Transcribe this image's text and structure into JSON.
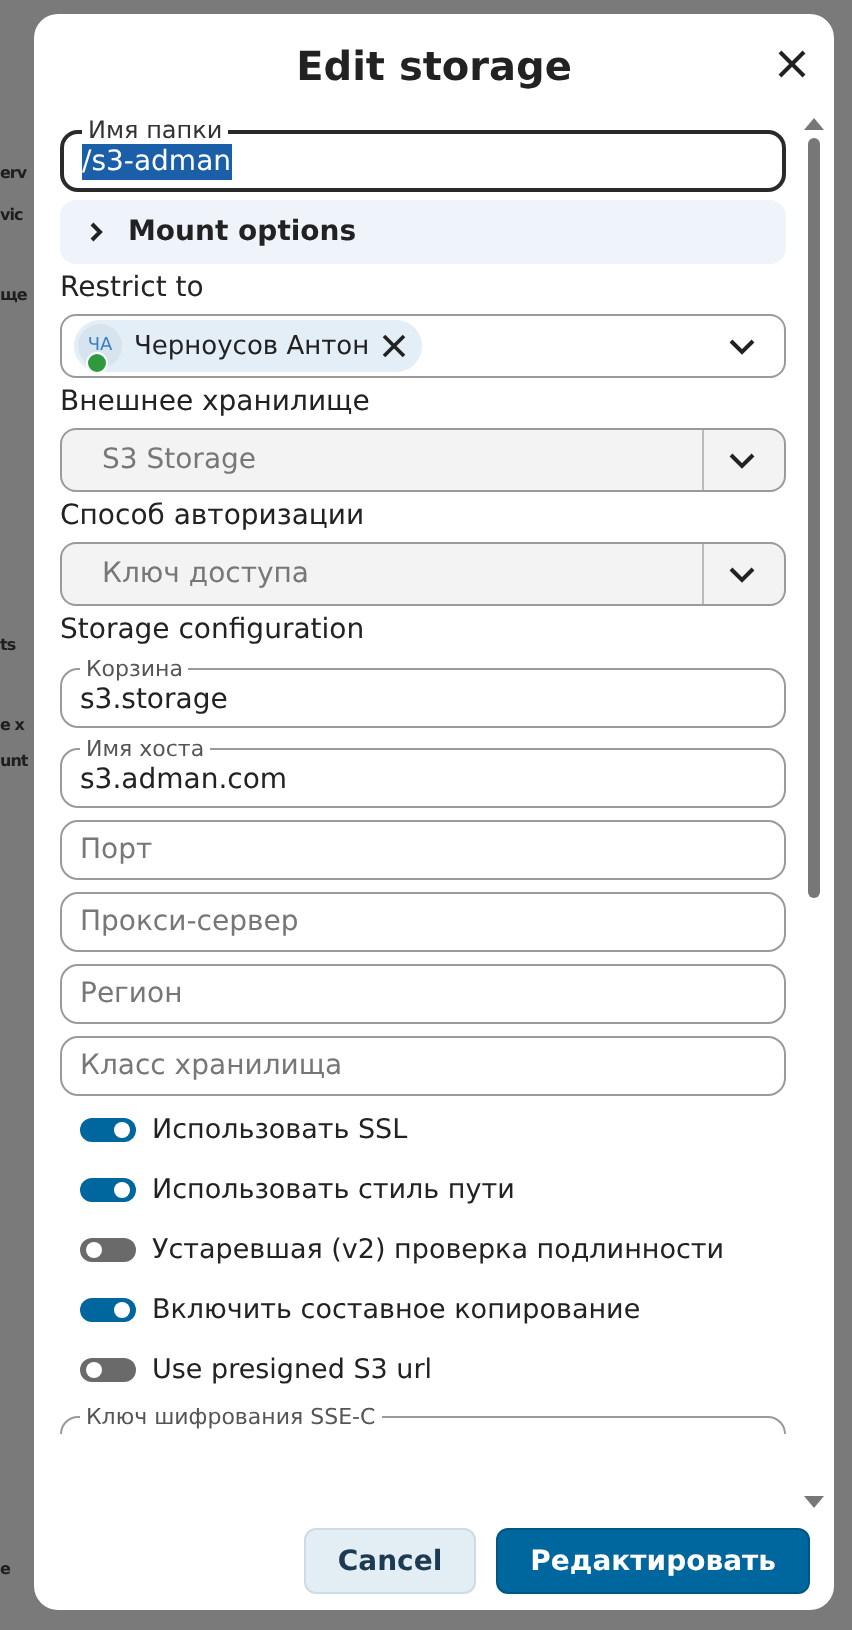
{
  "background": {
    "fragments": [
      {
        "text": "erv"
      },
      {
        "text": "vic"
      },
      {
        "text": "ще"
      },
      {
        "text": "ts"
      },
      {
        "text": "e x"
      },
      {
        "text": "unt"
      },
      {
        "text": "e"
      }
    ]
  },
  "dialog": {
    "title": "Edit storage"
  },
  "folder": {
    "label": "Имя папки",
    "value": "/s3-adman",
    "text_selected": true,
    "focused": true
  },
  "mount_options": {
    "label": "Mount options",
    "expanded": false
  },
  "restrict": {
    "label": "Restrict to",
    "chips": [
      {
        "initials": "ЧА",
        "name": "Черноусов Антон",
        "online": true
      }
    ]
  },
  "selects": [
    {
      "label": "Внешнее хранилище",
      "value": "S3 Storage",
      "disabled": true
    },
    {
      "label": "Способ авторизации",
      "value": "Ключ доступа",
      "disabled": true
    }
  ],
  "config": {
    "heading": "Storage configuration",
    "fields": [
      {
        "label": "Корзина",
        "value": "s3.storage"
      },
      {
        "label": "Имя хоста",
        "value": "s3.adman.com"
      },
      {
        "placeholder": "Порт"
      },
      {
        "placeholder": "Прокси-сервер"
      },
      {
        "placeholder": "Регион"
      },
      {
        "placeholder": "Класс хранилища"
      }
    ],
    "toggles": [
      {
        "label": "Использовать SSL",
        "checked": true
      },
      {
        "label": "Использовать стиль пути",
        "checked": true
      },
      {
        "label": "Устаревшая (v2) проверка подлинности",
        "checked": false
      },
      {
        "label": "Включить составное копирование",
        "checked": true
      },
      {
        "label": "Use presigned S3 url",
        "checked": false
      }
    ],
    "partial_field": {
      "label": "Ключ шифрования SSE-C"
    }
  },
  "buttons": [
    {
      "label": "Cancel",
      "kind": "secondary"
    },
    {
      "label": "Редактировать",
      "kind": "primary"
    }
  ]
}
